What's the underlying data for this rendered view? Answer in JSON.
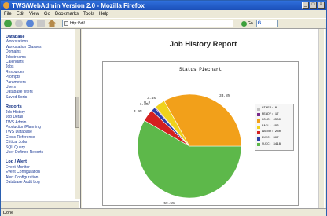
{
  "window": {
    "title": "TWS/WebAdmin Version 2.0 - Mozilla Firefox"
  },
  "menu": [
    "File",
    "Edit",
    "View",
    "Go",
    "Bookmarks",
    "Tools",
    "Help"
  ],
  "toolbar": {
    "url": "http://vtl/",
    "go_label": "Go",
    "search_glyph": "G"
  },
  "sidebar": {
    "sections": [
      {
        "header": "Database",
        "items": [
          "Workstations",
          "Workstation Classes",
          "Domains",
          "Jobstreams",
          "Calendars",
          "Jobs",
          "Resources",
          "Prompts",
          "Parameters",
          "Users",
          "Database filters",
          "Saved Sorts"
        ]
      },
      {
        "header": "Reports",
        "items": [
          "Job History",
          "Job Detail",
          "TWS Admin",
          "Production/Planning",
          "TWS Database",
          "Cross Reference",
          "Critical Jobs",
          "SQL Query",
          "User Defined Reports"
        ]
      },
      {
        "header": "Log / Alert",
        "items": [
          "Event Monitor",
          "Event Configuration",
          "Alert Configuration",
          "Database Audit Log"
        ]
      }
    ]
  },
  "main": {
    "page_title": "Job History Report"
  },
  "chart_data": {
    "type": "pie",
    "title": "Status Piechart",
    "slices": [
      {
        "label": "SUCC",
        "legend": "SUCC: 3418",
        "value": 59.5,
        "pct_label": "59.5%",
        "color": "#5db84a"
      },
      {
        "label": "HOLD",
        "legend": "HOLD: 4580",
        "value": 33.8,
        "pct_label": "33.8%",
        "color": "#f2a01a"
      },
      {
        "label": "FAIL",
        "legend": "FAIL: 496",
        "value": 3.4,
        "pct_label": "3.4%",
        "color": "#f0d21c"
      },
      {
        "label": "ABEND",
        "legend": "ABEND: 230",
        "value": 3.9,
        "pct_label": "3.9%",
        "color": "#d42020"
      },
      {
        "label": "EXEC",
        "legend": "EXEC: 307",
        "value": 1.3,
        "pct_label": "1.3%",
        "color": "#2d3fa8"
      },
      {
        "label": "READY",
        "legend": "READY: 17",
        "value": 0.3,
        "pct_label": "0.3",
        "color": "#7a2a8a"
      },
      {
        "label": "OTHER",
        "legend": "OTHER: 0",
        "value": 0.0,
        "pct_label": "",
        "color": "#c0c0c0"
      }
    ],
    "legend_order": [
      "OTHER",
      "READY",
      "HOLD",
      "FAIL",
      "ABEND",
      "EXEC",
      "SUCC"
    ],
    "legend_position": "right"
  },
  "statusbar": {
    "text": "Done"
  }
}
